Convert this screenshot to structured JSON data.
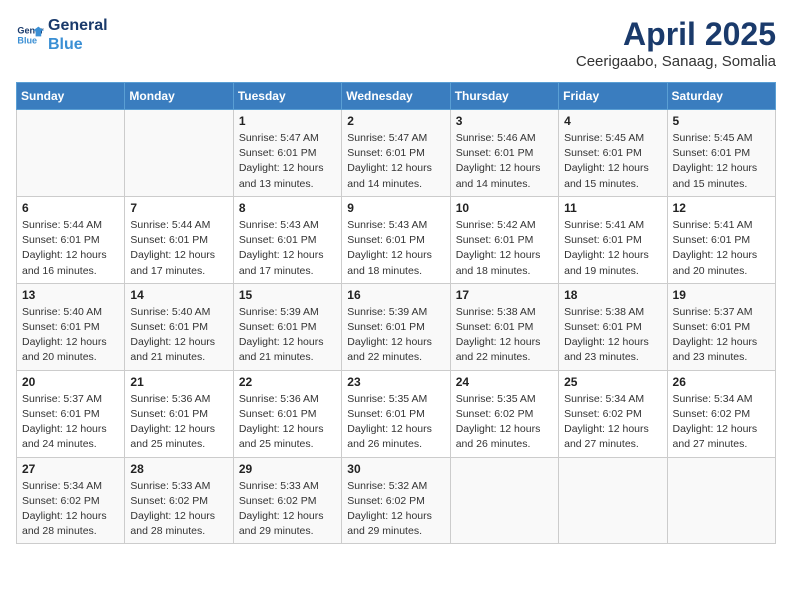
{
  "logo": {
    "line1": "General",
    "line2": "Blue"
  },
  "title": "April 2025",
  "subtitle": "Ceerigaabo, Sanaag, Somalia",
  "weekdays": [
    "Sunday",
    "Monday",
    "Tuesday",
    "Wednesday",
    "Thursday",
    "Friday",
    "Saturday"
  ],
  "weeks": [
    [
      {
        "day": "",
        "info": ""
      },
      {
        "day": "",
        "info": ""
      },
      {
        "day": "1",
        "info": "Sunrise: 5:47 AM\nSunset: 6:01 PM\nDaylight: 12 hours\nand 13 minutes."
      },
      {
        "day": "2",
        "info": "Sunrise: 5:47 AM\nSunset: 6:01 PM\nDaylight: 12 hours\nand 14 minutes."
      },
      {
        "day": "3",
        "info": "Sunrise: 5:46 AM\nSunset: 6:01 PM\nDaylight: 12 hours\nand 14 minutes."
      },
      {
        "day": "4",
        "info": "Sunrise: 5:45 AM\nSunset: 6:01 PM\nDaylight: 12 hours\nand 15 minutes."
      },
      {
        "day": "5",
        "info": "Sunrise: 5:45 AM\nSunset: 6:01 PM\nDaylight: 12 hours\nand 15 minutes."
      }
    ],
    [
      {
        "day": "6",
        "info": "Sunrise: 5:44 AM\nSunset: 6:01 PM\nDaylight: 12 hours\nand 16 minutes."
      },
      {
        "day": "7",
        "info": "Sunrise: 5:44 AM\nSunset: 6:01 PM\nDaylight: 12 hours\nand 17 minutes."
      },
      {
        "day": "8",
        "info": "Sunrise: 5:43 AM\nSunset: 6:01 PM\nDaylight: 12 hours\nand 17 minutes."
      },
      {
        "day": "9",
        "info": "Sunrise: 5:43 AM\nSunset: 6:01 PM\nDaylight: 12 hours\nand 18 minutes."
      },
      {
        "day": "10",
        "info": "Sunrise: 5:42 AM\nSunset: 6:01 PM\nDaylight: 12 hours\nand 18 minutes."
      },
      {
        "day": "11",
        "info": "Sunrise: 5:41 AM\nSunset: 6:01 PM\nDaylight: 12 hours\nand 19 minutes."
      },
      {
        "day": "12",
        "info": "Sunrise: 5:41 AM\nSunset: 6:01 PM\nDaylight: 12 hours\nand 20 minutes."
      }
    ],
    [
      {
        "day": "13",
        "info": "Sunrise: 5:40 AM\nSunset: 6:01 PM\nDaylight: 12 hours\nand 20 minutes."
      },
      {
        "day": "14",
        "info": "Sunrise: 5:40 AM\nSunset: 6:01 PM\nDaylight: 12 hours\nand 21 minutes."
      },
      {
        "day": "15",
        "info": "Sunrise: 5:39 AM\nSunset: 6:01 PM\nDaylight: 12 hours\nand 21 minutes."
      },
      {
        "day": "16",
        "info": "Sunrise: 5:39 AM\nSunset: 6:01 PM\nDaylight: 12 hours\nand 22 minutes."
      },
      {
        "day": "17",
        "info": "Sunrise: 5:38 AM\nSunset: 6:01 PM\nDaylight: 12 hours\nand 22 minutes."
      },
      {
        "day": "18",
        "info": "Sunrise: 5:38 AM\nSunset: 6:01 PM\nDaylight: 12 hours\nand 23 minutes."
      },
      {
        "day": "19",
        "info": "Sunrise: 5:37 AM\nSunset: 6:01 PM\nDaylight: 12 hours\nand 23 minutes."
      }
    ],
    [
      {
        "day": "20",
        "info": "Sunrise: 5:37 AM\nSunset: 6:01 PM\nDaylight: 12 hours\nand 24 minutes."
      },
      {
        "day": "21",
        "info": "Sunrise: 5:36 AM\nSunset: 6:01 PM\nDaylight: 12 hours\nand 25 minutes."
      },
      {
        "day": "22",
        "info": "Sunrise: 5:36 AM\nSunset: 6:01 PM\nDaylight: 12 hours\nand 25 minutes."
      },
      {
        "day": "23",
        "info": "Sunrise: 5:35 AM\nSunset: 6:01 PM\nDaylight: 12 hours\nand 26 minutes."
      },
      {
        "day": "24",
        "info": "Sunrise: 5:35 AM\nSunset: 6:02 PM\nDaylight: 12 hours\nand 26 minutes."
      },
      {
        "day": "25",
        "info": "Sunrise: 5:34 AM\nSunset: 6:02 PM\nDaylight: 12 hours\nand 27 minutes."
      },
      {
        "day": "26",
        "info": "Sunrise: 5:34 AM\nSunset: 6:02 PM\nDaylight: 12 hours\nand 27 minutes."
      }
    ],
    [
      {
        "day": "27",
        "info": "Sunrise: 5:34 AM\nSunset: 6:02 PM\nDaylight: 12 hours\nand 28 minutes."
      },
      {
        "day": "28",
        "info": "Sunrise: 5:33 AM\nSunset: 6:02 PM\nDaylight: 12 hours\nand 28 minutes."
      },
      {
        "day": "29",
        "info": "Sunrise: 5:33 AM\nSunset: 6:02 PM\nDaylight: 12 hours\nand 29 minutes."
      },
      {
        "day": "30",
        "info": "Sunrise: 5:32 AM\nSunset: 6:02 PM\nDaylight: 12 hours\nand 29 minutes."
      },
      {
        "day": "",
        "info": ""
      },
      {
        "day": "",
        "info": ""
      },
      {
        "day": "",
        "info": ""
      }
    ]
  ]
}
